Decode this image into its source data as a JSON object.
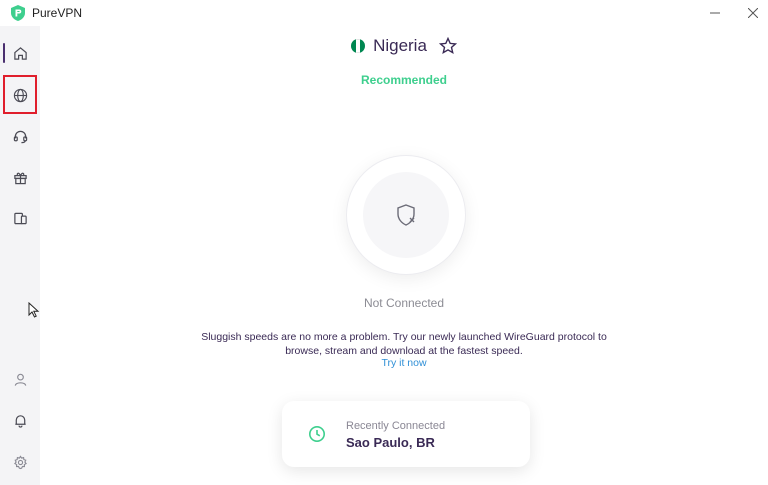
{
  "app": {
    "title": "PureVPN"
  },
  "window_controls": {
    "minimize_icon": "minimize-icon",
    "close_icon": "close-icon"
  },
  "sidebar": {
    "items": [
      {
        "name": "home",
        "icon": "home-icon",
        "active": true
      },
      {
        "name": "locations",
        "icon": "globe-icon",
        "highlighted": true
      },
      {
        "name": "support",
        "icon": "headset-icon"
      },
      {
        "name": "offers",
        "icon": "gift-icon"
      },
      {
        "name": "devices",
        "icon": "devices-icon"
      },
      {
        "name": "account",
        "icon": "user-icon"
      },
      {
        "name": "notifications",
        "icon": "bell-icon"
      },
      {
        "name": "settings",
        "icon": "gear-icon"
      }
    ]
  },
  "location": {
    "country": "Nigeria",
    "favorite_icon": "star-icon",
    "badge": "Recommended"
  },
  "connection": {
    "status": "Not Connected",
    "icon": "shield-x-icon"
  },
  "promo": {
    "text": "Sluggish speeds are no more a problem. Try our newly launched WireGuard protocol to browse, stream and download at the fastest speed.",
    "link": "Try it now"
  },
  "recent": {
    "label": "Recently Connected",
    "value": "Sao Paulo, BR",
    "icon": "clock-icon"
  },
  "colors": {
    "accent": "#3ecf8e",
    "brand": "#3a2a55",
    "link": "#2f8fd6",
    "highlight": "#e01e2c"
  }
}
